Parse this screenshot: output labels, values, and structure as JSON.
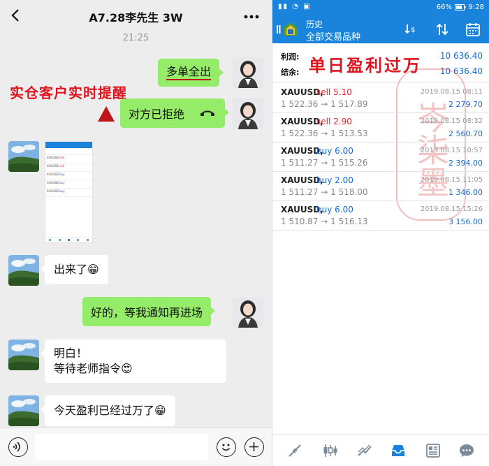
{
  "chat": {
    "title": "A7.28李先生 3W",
    "time": "21:25",
    "overlay_text": "实仓客户实时提醒",
    "messages": {
      "m1": "多单全出",
      "m2": "对方已拒绝",
      "m4": "出来了😁",
      "m5": "好的，等我通知再进场",
      "m6_line1": "明白！",
      "m6_line2": "等待老师指令😍",
      "m7": "今天盈利已经过万了😁"
    }
  },
  "thumbnail": {
    "rows": [
      "XAUUSD",
      "XAUUSD",
      "XAUUSD",
      "XAUUSD",
      "XAUUSD"
    ]
  },
  "app": {
    "status": {
      "battery": "66%",
      "clock": "9:28"
    },
    "title": "历史",
    "subtitle": "全部交易品种",
    "profit_label": "利润:",
    "profit_value": "10 636.40",
    "balance_label": "结余:",
    "balance_value": "10 636.40",
    "stamp_title": "单日盈利过万",
    "seal_text": "岑柒墨",
    "deals": [
      {
        "symbol": "XAUUSD,",
        "side": "sell 5.10",
        "side_type": "sell",
        "prices": "1 522.36 → 1 517.89",
        "datetime": "2019.08.15 08:11",
        "profit": "2 279.70"
      },
      {
        "symbol": "XAUUSD,",
        "side": "sell 2.90",
        "side_type": "sell",
        "prices": "1 522.36 → 1 513.53",
        "datetime": "2019.08.15 08:32",
        "profit": "2 560.70"
      },
      {
        "symbol": "XAUUSD,",
        "side": "buy 6.00",
        "side_type": "buy",
        "prices": "1 511.27 → 1 515.26",
        "datetime": "2019.08.15 10:57",
        "profit": "2 394.00"
      },
      {
        "symbol": "XAUUSD,",
        "side": "buy 2.00",
        "side_type": "buy",
        "prices": "1 511.27 → 1 518.00",
        "datetime": "2019.08.15 11:05",
        "profit": "1 346.00"
      },
      {
        "symbol": "XAUUSD,",
        "side": "buy 6.00",
        "side_type": "buy",
        "prices": "1 510.87 → 1 516.13",
        "datetime": "2019.08.15 15:26",
        "profit": "3 156.00"
      }
    ]
  },
  "colors": {
    "wechat_green": "#95ec69",
    "app_blue": "#1a84dd",
    "sell_red": "#d9272e",
    "buy_blue": "#1669d1",
    "annotation_red": "#e0141e"
  },
  "icons": {
    "chat_header": [
      "back-icon",
      "more-icon"
    ],
    "chat_input": [
      "voice-icon",
      "emoji-icon",
      "plus-icon"
    ],
    "app_bar": [
      "menu-icon",
      "app-logo",
      "sort-icon",
      "arrows-icon",
      "calendar-icon"
    ],
    "bottom_nav": [
      "quotes-icon",
      "chart-icon",
      "trade-icon",
      "history-icon",
      "news-icon",
      "messages-icon"
    ]
  }
}
